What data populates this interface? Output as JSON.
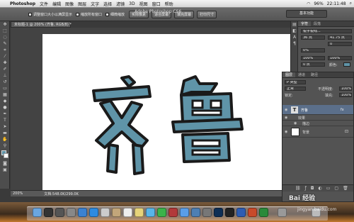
{
  "menubar": {
    "app": "Photoshop",
    "items": [
      "文件",
      "编辑",
      "图像",
      "图层",
      "文字",
      "选择",
      "滤镜",
      "3D",
      "视图",
      "窗口",
      "帮助"
    ],
    "battery": "96%",
    "time": "22:11:48"
  },
  "window": {
    "title": "Adobe Photoshop CS6"
  },
  "options": {
    "check1": "调整窗口大小以满屏显示",
    "check2": "缩放所有窗口",
    "check3": "细微缩放",
    "btn_actual": "实际像素",
    "btn_fit": "适合屏幕",
    "btn_fill": "填充屏幕",
    "btn_print": "打印尺寸",
    "workspace": "基本功能"
  },
  "document": {
    "tab": "未标题-1 @ 200% (齐鲁, RGB/8) *",
    "zoom": "200%",
    "docsize": "文档:548.0K/299.0K"
  },
  "artwork": {
    "text": "齐鲁",
    "fill_color": "#5f94a8",
    "stroke_color": "#1a1a1a"
  },
  "character_panel": {
    "tabs": [
      "字符",
      "段落"
    ],
    "font": "锐字锐线...",
    "size": "36 点",
    "leading": "41.75 点",
    "tracking": "0",
    "scale_v": "100%",
    "scale_h": "100%",
    "baseline": "0 点",
    "color_label": "颜色:",
    "percent": "0%"
  },
  "layers_panel": {
    "tabs": [
      "图层",
      "通道",
      "路径"
    ],
    "kind": "P 类型",
    "blend": "正常",
    "opacity_label": "不透明度:",
    "opacity": "100%",
    "lock_label": "锁定:",
    "fill_label": "填充:",
    "fill": "100%",
    "layers": [
      {
        "name": "齐鲁",
        "type": "text"
      },
      {
        "name": "效果",
        "type": "effects"
      },
      {
        "name": "描边",
        "type": "effect"
      },
      {
        "name": "背景",
        "type": "background"
      }
    ]
  },
  "watermark": {
    "text": "Bai 经验",
    "url": "jingyan.baidu.com"
  },
  "icons": {
    "apple": "apple-icon",
    "wifi": "wifi-icon",
    "search": "spotlight-icon"
  }
}
